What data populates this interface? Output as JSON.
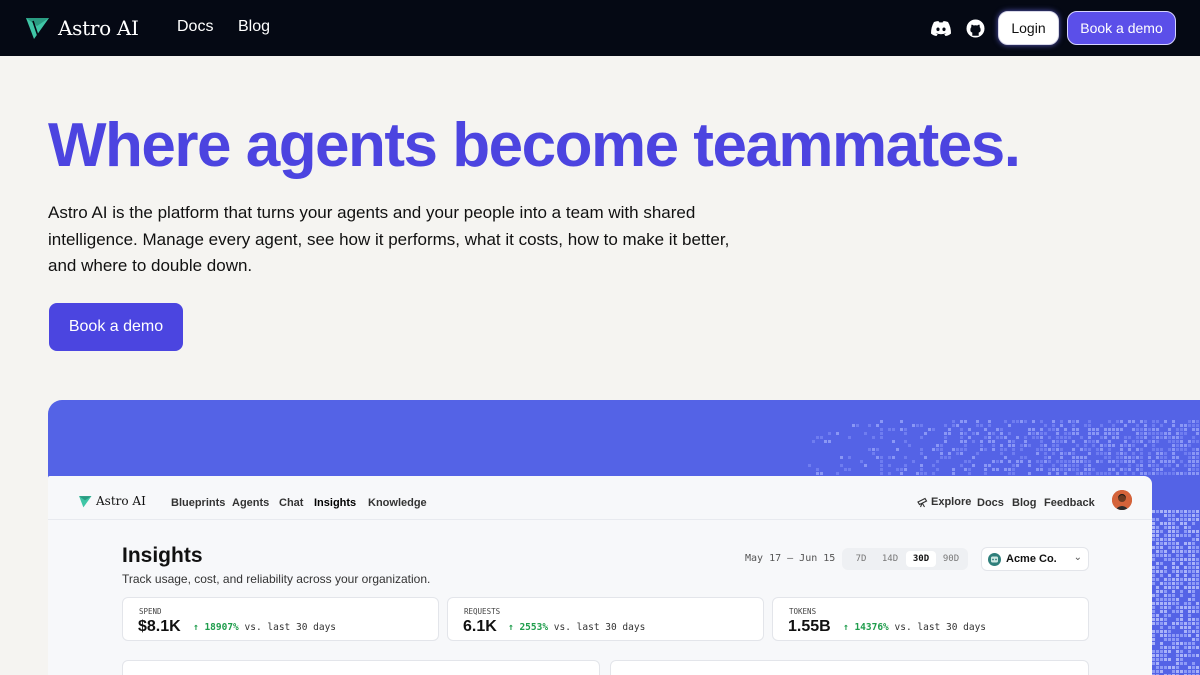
{
  "nav": {
    "brand": "Astro AI",
    "links": [
      "Docs",
      "Blog"
    ],
    "icons": [
      "discord-icon",
      "github-icon"
    ],
    "login_label": "Login",
    "demo_label": "Book a demo"
  },
  "hero": {
    "title": "Where agents become teammates.",
    "body": "Astro AI is the platform that turns your agents and your people into a team with shared intelligence. Manage every agent, see how it performs, what it costs, how to make it better, and where to double down.",
    "cta_label": "Book a demo"
  },
  "app": {
    "brand": "Astro AI",
    "nav_left": [
      "Blueprints",
      "Agents",
      "Chat",
      "Insights",
      "Knowledge"
    ],
    "active_nav": "Insights",
    "nav_right": [
      "Explore",
      "Docs",
      "Blog",
      "Feedback"
    ],
    "page_title": "Insights",
    "page_subtitle": "Track usage, cost, and reliability across your organization.",
    "date_range": "May 17 – Jun 15",
    "ranges": [
      "7D",
      "14D",
      "30D",
      "90D"
    ],
    "active_range": "30D",
    "org": "Acme Co.",
    "metrics": [
      {
        "label": "SPEND",
        "value": "$8.1K",
        "delta": "↑ 18907%",
        "suffix": "vs. last 30 days"
      },
      {
        "label": "REQUESTS",
        "value": "6.1K",
        "delta": "↑ 2553%",
        "suffix": "vs. last 30 days"
      },
      {
        "label": "TOKENS",
        "value": "1.55B",
        "delta": "↑ 14376%",
        "suffix": "vs. last 30 days"
      }
    ]
  },
  "colors": {
    "brand": "#4c44e0",
    "nav_bg": "#050914",
    "showcase": "#5463e6",
    "positive": "#1f9d4c"
  }
}
